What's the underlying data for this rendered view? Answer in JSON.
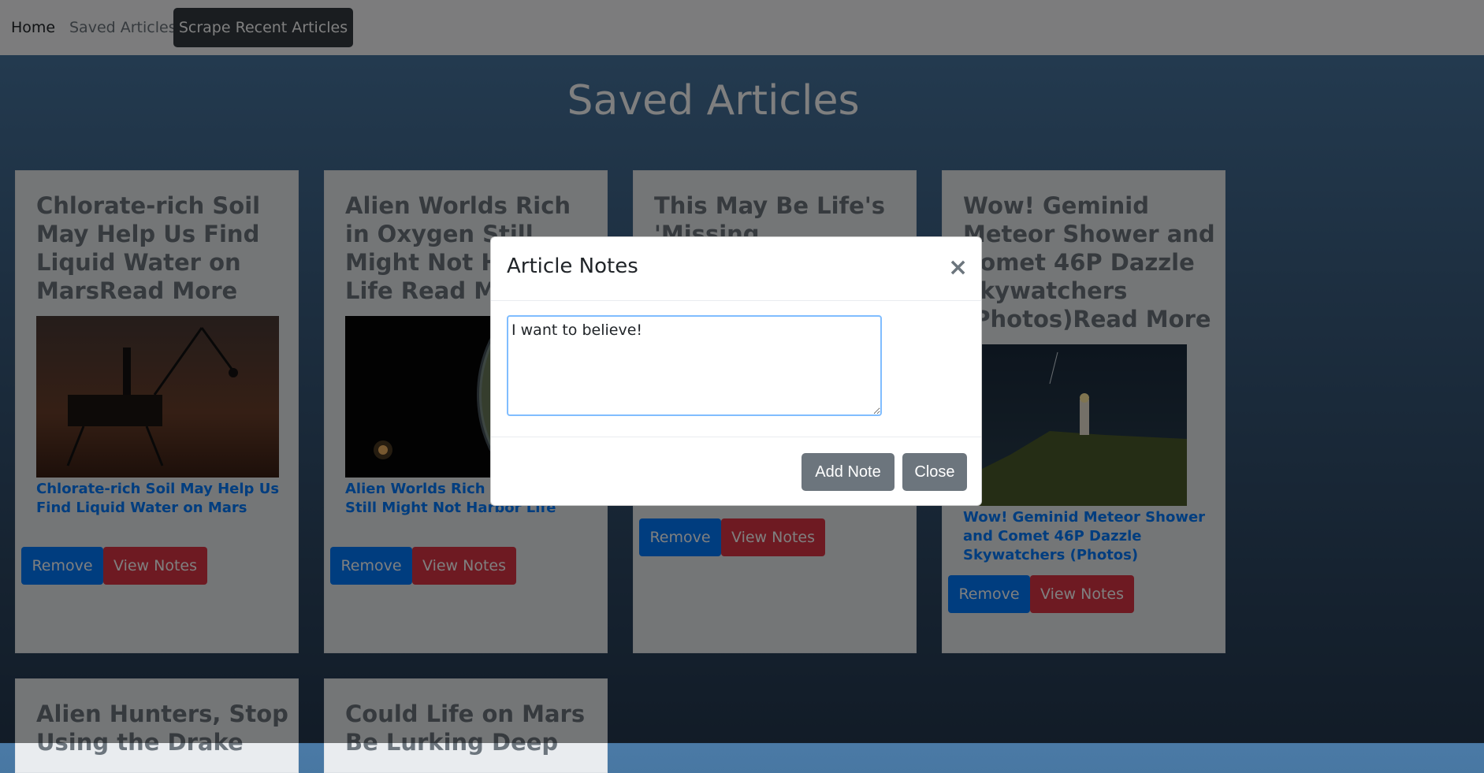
{
  "nav": {
    "home": "Home",
    "saved": "Saved Articles",
    "scrape": "Scrape Recent Articles"
  },
  "page": {
    "title": "Saved Articles"
  },
  "cards": [
    {
      "title": "Chlorate-rich Soil May Help Us Find Liquid Water on MarsRead More",
      "link": "Chlorate-rich Soil May Help Us Find Liquid Water on Mars",
      "remove": "Remove",
      "notes": "View Notes"
    },
    {
      "title": "Alien Worlds Rich in Oxygen Still Might Not Harbor Life Read More",
      "link": "Alien Worlds Rich in Oxygen Still Might Not Harbor Life",
      "remove": "Remove",
      "notes": "View Notes"
    },
    {
      "title": "This May Be Life's 'Missing",
      "link": "",
      "remove": "Remove",
      "notes": "View Notes"
    },
    {
      "title": "Wow! Geminid Meteor Shower and Comet 46P Dazzle Skywatchers (Photos)Read More",
      "link": "Wow! Geminid Meteor Shower and Comet 46P Dazzle Skywatchers (Photos)",
      "remove": "Remove",
      "notes": "View Notes"
    },
    {
      "title": "Alien Hunters, Stop Using the Drake"
    },
    {
      "title": "Could Life on Mars Be Lurking Deep"
    }
  ],
  "modal": {
    "title": "Article Notes",
    "close_symbol": "×",
    "note_value": "I want to believe!",
    "add_label": "Add Note",
    "close_label": "Close"
  },
  "colors": {
    "remove": "#007bff",
    "view_notes": "#dc3545",
    "modal_buttons": "#6c757d"
  }
}
